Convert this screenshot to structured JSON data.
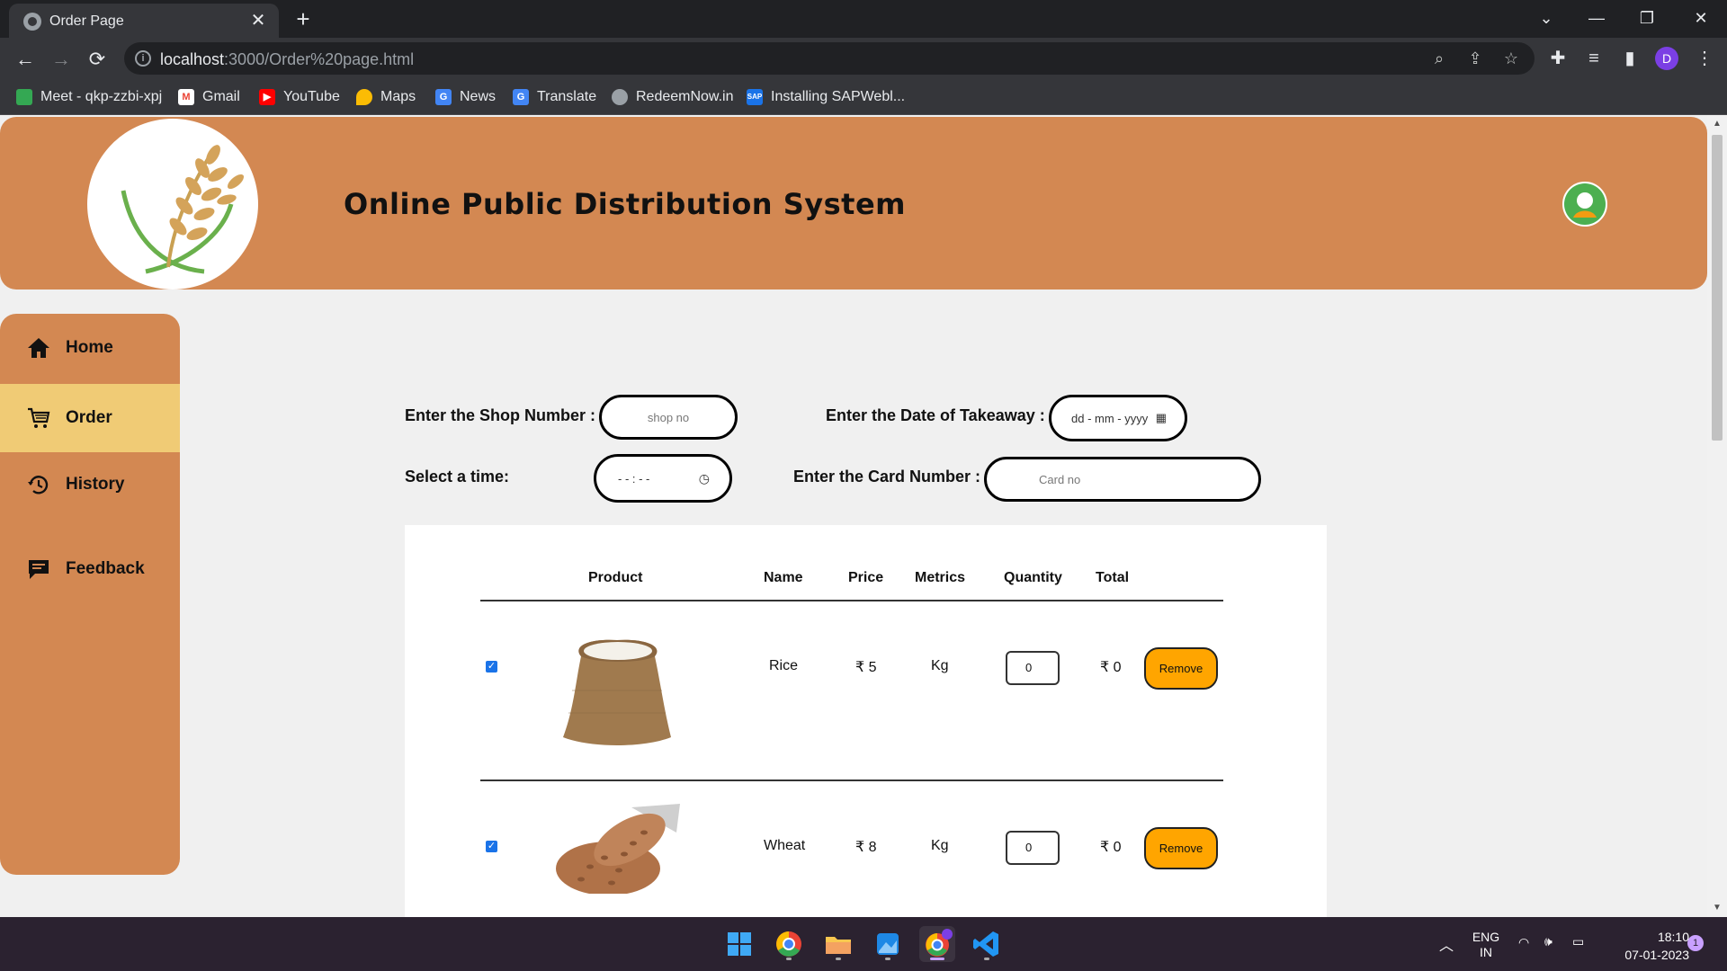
{
  "browser": {
    "tab_title": "Order Page",
    "url_host": "localhost",
    "url_rest": ":3000/Order%20page.html",
    "profile_initial": "D",
    "bookmarks": [
      {
        "label": "Meet - qkp-zzbi-xpj",
        "color": "#34a853"
      },
      {
        "label": "Gmail",
        "color": "#ea4335"
      },
      {
        "label": "YouTube",
        "color": "#ff0000"
      },
      {
        "label": "Maps",
        "color": "#fbbc04"
      },
      {
        "label": "News",
        "color": "#4285f4"
      },
      {
        "label": "Translate",
        "color": "#4285f4"
      },
      {
        "label": "RedeemNow.in",
        "color": "#9aa0a6"
      },
      {
        "label": "Installing SAPWebl...",
        "color": "#1a73e8"
      }
    ]
  },
  "header": {
    "title": "Online Public Distribution System"
  },
  "sidebar": {
    "items": [
      {
        "label": "Home",
        "icon": "home-icon"
      },
      {
        "label": "Order",
        "icon": "cart-icon",
        "active": true
      },
      {
        "label": "History",
        "icon": "history-icon"
      },
      {
        "label": "Feedback",
        "icon": "feedback-icon"
      }
    ]
  },
  "form": {
    "shop_label": "Enter the Shop Number :",
    "shop_placeholder": "shop no",
    "date_label": "Enter the Date of Takeaway :",
    "date_placeholder": "dd - mm - yyyy",
    "time_label": "Select a time:",
    "time_placeholder": "- - : - -",
    "card_label": "Enter the Card Number :",
    "card_placeholder": "Card no"
  },
  "table": {
    "headers": [
      "Product",
      "Name",
      "Price",
      "Metrics",
      "Quantity",
      "Total"
    ],
    "rows": [
      {
        "name": "Rice",
        "price": "₹ 5",
        "metrics": "Kg",
        "quantity": "0",
        "total": "₹ 0",
        "action": "Remove",
        "checked": true
      },
      {
        "name": "Wheat",
        "price": "₹ 8",
        "metrics": "Kg",
        "quantity": "0",
        "total": "₹ 0",
        "action": "Remove",
        "checked": true
      }
    ]
  },
  "taskbar": {
    "lang_line1": "ENG",
    "lang_line2": "IN",
    "time": "18:10",
    "date": "07-01-2023",
    "notifications": "1"
  },
  "colors": {
    "header_bg": "#d38852",
    "sidebar_active": "#f0cb75",
    "remove_button": "#ffa500",
    "page_bg": "#f0f0f0"
  }
}
